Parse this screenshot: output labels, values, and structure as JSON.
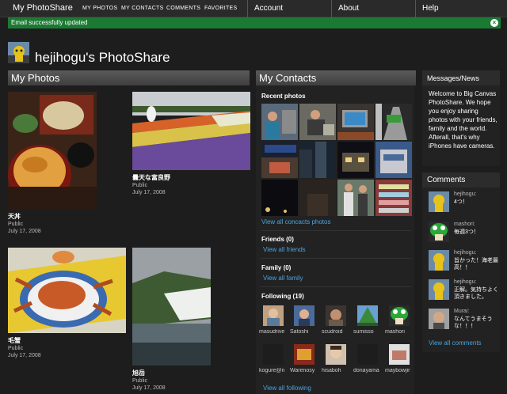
{
  "topbar": {
    "app_title": "My PhotoShare",
    "nav": [
      "MY PHOTOS",
      "MY CONTACTS",
      "COMMENTS",
      "FAVORITES"
    ],
    "menus": [
      "Account",
      "About",
      "Help"
    ]
  },
  "notice": {
    "message": "Email successfully updated",
    "close_icon": "close-icon"
  },
  "header": {
    "title": "hejihogu's PhotoShare"
  },
  "my_photos": {
    "heading": "My Photos",
    "items": [
      {
        "title": "天丼",
        "visibility": "Public",
        "date": "July 17, 2008"
      },
      {
        "title": "曇天な富良野",
        "visibility": "Public",
        "date": "July 17, 2008"
      },
      {
        "title": "毛蟹",
        "visibility": "Public",
        "date": "July 17, 2008"
      },
      {
        "title": "旭岳",
        "visibility": "Public",
        "date": "July 17, 2008"
      }
    ]
  },
  "contacts": {
    "heading": "My Contacts",
    "recent_label": "Recent photos",
    "view_all_photos": "View all concacts photos",
    "friends_label": "Friends (0)",
    "view_all_friends": "View all friends",
    "family_label": "Family (0)",
    "view_all_family": "View all family",
    "following_label": "Following (19)",
    "following": [
      "masudrive",
      "Satoshi",
      "scudroid",
      "sumisso",
      "mashori",
      "kogure@n",
      "Warenosy",
      "hisaboh",
      "donayama",
      "maybowjir"
    ],
    "view_all_following": "View all following"
  },
  "sidebar": {
    "messages_heading": "Messages/News",
    "welcome_text": "Welcome to Big Canvas PhotoShare. We hope you enjoy sharing photos with your friends, family and the world. Afterall, that's why iPhones have cameras.",
    "comments_heading": "Comments",
    "comments": [
      {
        "name": "hejihogu:",
        "text": "4つ！"
      },
      {
        "name": "mashori:",
        "text": "毎週3つ！"
      },
      {
        "name": "hejihogu:",
        "text": "旨かった！海老最高！！"
      },
      {
        "name": "hejihogu:",
        "text": "正解。気持ちよく頂きました。"
      },
      {
        "name": "Murai:",
        "text": "なんてうまそうな！！！"
      }
    ],
    "view_all_comments": "View all comments"
  },
  "colors": {
    "notice": "#1b7a32",
    "link": "#4aa3df",
    "background": "#1d1d1d"
  }
}
